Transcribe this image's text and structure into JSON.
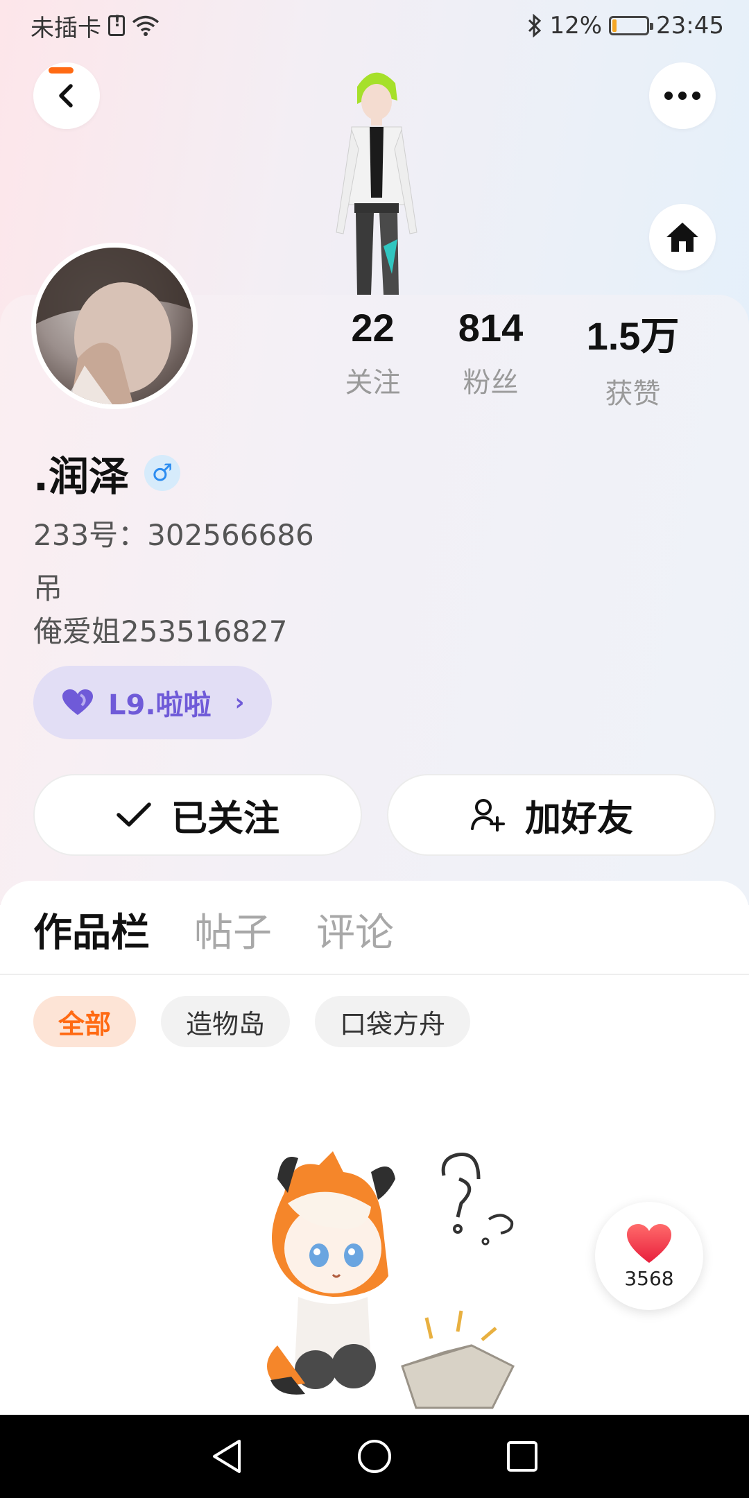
{
  "status_bar": {
    "carrier": "未插卡",
    "battery": "12%",
    "battery_level": 0.12,
    "time": "23:45"
  },
  "header": {
    "back_icon": "chevron-left-icon",
    "more_icon": "ellipsis-icon",
    "home_icon": "home-icon"
  },
  "profile": {
    "stats": [
      {
        "value": "22",
        "label": "关注"
      },
      {
        "value": "814",
        "label": "粉丝"
      },
      {
        "value": "1.5万",
        "label": "获赞"
      }
    ],
    "name": ".润泽",
    "gender_symbol": "♂",
    "uid": "233号：302566686",
    "bio_lines": [
      "吊",
      "俺爱姐253516827"
    ],
    "level_label": "L9.啦啦",
    "accent_color": "#ff6a13",
    "level_color": "#6f5ad8"
  },
  "actions": {
    "follow_label": "已关注",
    "add_friend_label": "加好友"
  },
  "tabs": [
    {
      "label": "作品栏",
      "active": true
    },
    {
      "label": "帖子",
      "active": false
    },
    {
      "label": "评论",
      "active": false
    }
  ],
  "filters": [
    {
      "label": "全部",
      "active": true
    },
    {
      "label": "造物岛",
      "active": false
    },
    {
      "label": "口袋方舟",
      "active": false
    }
  ],
  "floating_like": {
    "count": "3568",
    "icon": "heart-icon"
  }
}
